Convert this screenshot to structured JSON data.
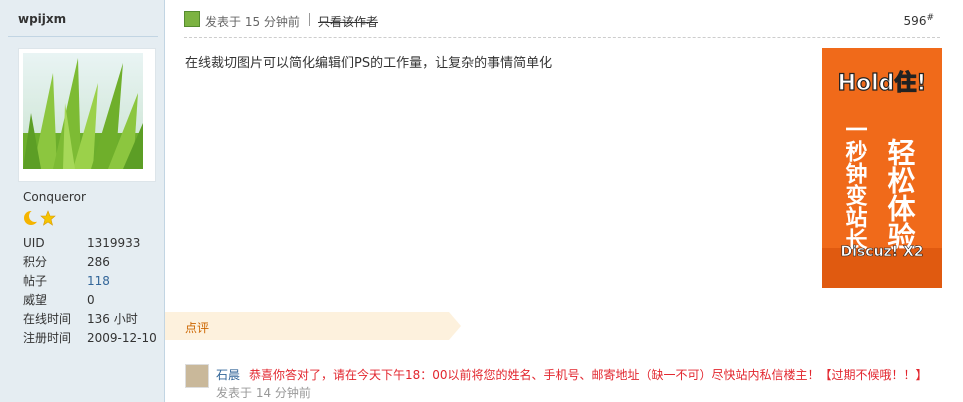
{
  "author": {
    "username": "wpijxm",
    "rank_title": "Conqueror",
    "rank_icons": [
      "moon-icon",
      "star-icon"
    ],
    "stats": [
      {
        "label": "UID",
        "value": "1319933"
      },
      {
        "label": "积分",
        "value": "286"
      },
      {
        "label": "帖子",
        "value": "118"
      },
      {
        "label": "威望",
        "value": "0"
      },
      {
        "label": "在线时间",
        "value": "136 小时"
      },
      {
        "label": "注册时间",
        "value": "2009-12-10"
      }
    ]
  },
  "post": {
    "posted_time": "发表于 15 分钟前",
    "author_only_label": "只看该作者",
    "floor": "596",
    "floor_mark": "#",
    "message": "在线裁切图片可以简化编辑们PS的工作量，让复杂的事情简单化"
  },
  "ad": {
    "headline": "Hold住!",
    "lines": [
      "轻松体验",
      "一秒钟变站长"
    ],
    "brand": "Discuz! X2"
  },
  "comments": {
    "section_title": "点评",
    "items": [
      {
        "author": "石晨",
        "text": "恭喜你答对了，请在今天下午18：00以前将您的姓名、手机号、邮寄地址（缺一不可）尽快站内私信楼主！【过期不候哦！！】",
        "time": "发表于 14 分钟前"
      }
    ]
  },
  "colors": {
    "sidebar_bg": "#e5edf2",
    "link": "#336699",
    "comment_text": "#e2262e",
    "ad_bg": "#f06a1a"
  }
}
